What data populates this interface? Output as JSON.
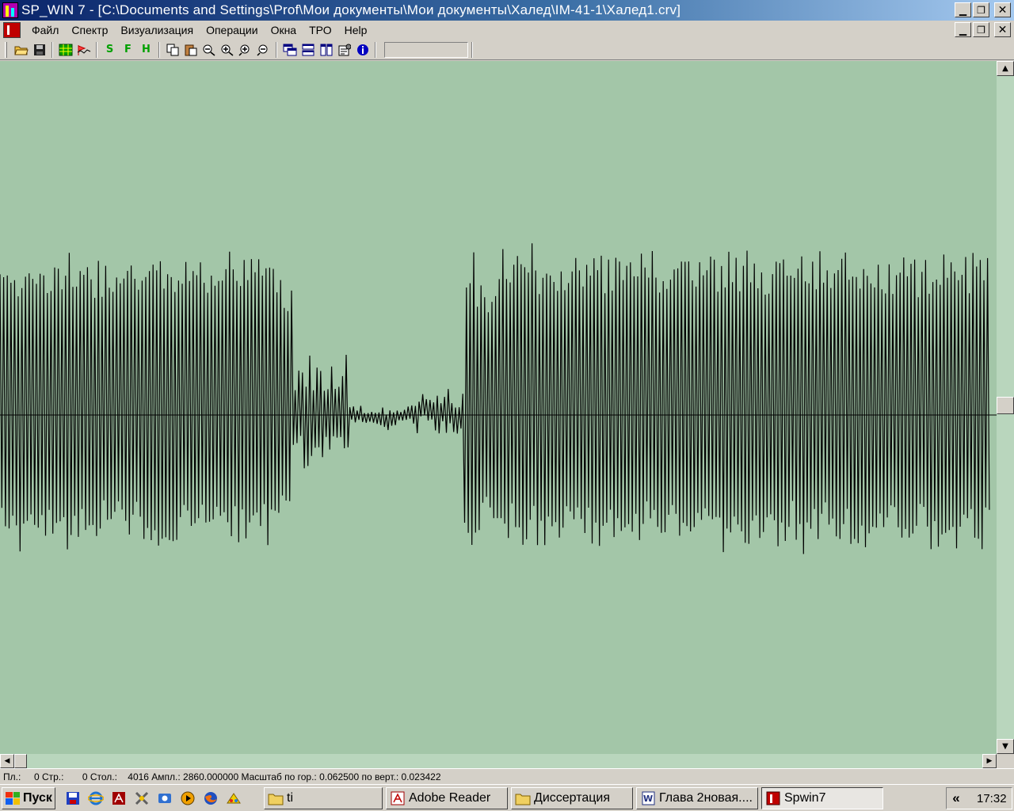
{
  "window": {
    "title": "SP_WIN 7 - [C:\\Documents and Settings\\Prof\\Мои документы\\Мои документы\\Халед\\IM-41-1\\Халед1.crv]"
  },
  "menu": {
    "items": [
      "Файл",
      "Спектр",
      "Визуализация",
      "Операции",
      "Окна",
      "ТРО",
      "Help"
    ]
  },
  "toolbar": {
    "icons": [
      "open-folder-icon",
      "save-icon",
      "grid-icon",
      "flag-chart-icon",
      "s-letter-icon",
      "f-letter-icon",
      "h-letter-icon",
      "copy-icon",
      "paste-icon",
      "zoom-in-x-icon",
      "zoom-out-x-icon",
      "zoom-in-y-icon",
      "zoom-out-y-icon",
      "cascade-windows-icon",
      "tile-horizontal-icon",
      "tile-vertical-icon",
      "properties-icon",
      "info-icon"
    ],
    "letter_s": "S",
    "letter_f": "F",
    "letter_h": "H"
  },
  "status": {
    "text": "Пл.:     0 Стр.:       0 Стол.:    4016 Ампл.: 2860.000000 Масштаб по гор.: 0.062500 по верт.: 0.023422"
  },
  "taskbar": {
    "start_label": "Пуск",
    "tasks": [
      {
        "label": "ti",
        "icon": "folder-icon"
      },
      {
        "label": "Adobe Reader",
        "icon": "adobe-reader-icon"
      },
      {
        "label": "Диссертация",
        "icon": "folder-icon"
      },
      {
        "label": "Глава 2новая....",
        "icon": "word-icon"
      },
      {
        "label": "Spwin7",
        "icon": "spwin-icon",
        "active": true
      }
    ],
    "tray_arrow": "«",
    "clock": "17:32"
  },
  "colors": {
    "plot_background": "#a3c6a8",
    "signal": "#000000",
    "title_bar": "#0a246a"
  }
}
